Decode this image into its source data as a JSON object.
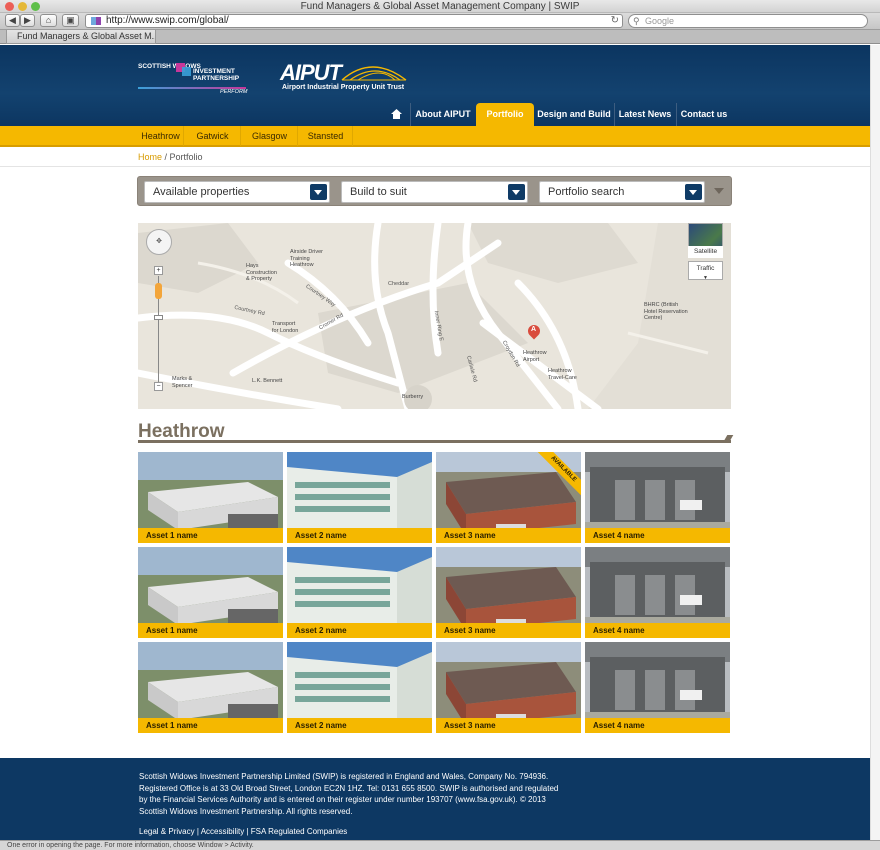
{
  "browser": {
    "window_title": "Fund Managers & Global Asset Management Company | SWIP",
    "url": "http://www.swip.com/global/",
    "search_placeholder": "Google",
    "tab_title": "Fund Managers & Global Asset M...",
    "status_text": "One error in opening the page. For more information, choose Window > Activity.",
    "back_icon": "back-arrow-icon",
    "forward_icon": "forward-arrow-icon"
  },
  "header": {
    "swip_logo_line1": "SCOTTISH WIDOWS",
    "swip_logo_line2": "INVESTMENT PARTNERSHIP",
    "swip_logo_tag": "PERFORM",
    "aiput_logo": "AIPUT",
    "aiput_subtitle": "Airport Industrial Property Unit Trust",
    "accent": "#f5b800",
    "brand_blue": "#0d3863"
  },
  "nav": {
    "home_icon": "home-icon",
    "items": [
      "About AIPUT",
      "Portfolio",
      "Design and Build",
      "Latest News",
      "Contact us"
    ],
    "active": "Portfolio"
  },
  "subnav": {
    "items": [
      "Heathrow",
      "Gatwick",
      "Glasgow",
      "Stansted"
    ]
  },
  "breadcrumb": {
    "home": "Home",
    "separator": " / ",
    "current": "Portfolio"
  },
  "filters": {
    "available": "Available properties",
    "build": "Build to suit",
    "search": "Portfolio search"
  },
  "map": {
    "satellite": "Satellite",
    "traffic": "Traffic",
    "marker": "A",
    "labels": {
      "airside": "Airside Driver\nTraining\nHeathrow",
      "hays": "Hays\nConstruction\n& Property",
      "courtney_rd": "Courtney Rd",
      "courtney_way": "Courtney Way",
      "transport": "Transport\nfor London",
      "cromer_rd": "Cromer Rd",
      "marks": "Marks &\nSpencer",
      "lk_bennett": "L.K. Bennett",
      "burberry": "Burberry",
      "bhrc": "BHRC (British\nHotel Reservation\nCentre)",
      "heathrow_airport": "Heathrow\nAirport",
      "travel_care": "Heathrow\nTravel-Care",
      "cheddar": "Cheddar",
      "inner_ring_e": "Inner Ring E",
      "croydon_rd": "Croydon Rd",
      "carlisle_rd": "Carlisle Rd"
    }
  },
  "section_title": "Heathrow",
  "available_badge": "AVAILABLE",
  "assets": [
    [
      "Asset 1 name",
      "Asset 2 name",
      "Asset 3 name",
      "Asset 4 name"
    ],
    [
      "Asset 1 name",
      "Asset 2 name",
      "Asset 3 name",
      "Asset 4 name"
    ],
    [
      "Asset 1 name",
      "Asset 2 name",
      "Asset 3 name",
      "Asset 4 name"
    ]
  ],
  "footer": {
    "text": "Scottish Widows Investment Partnership Limited (SWIP) is registered in England and Wales, Company No. 794936. Registered Office is at 33 Old Broad Street, London EC2N 1HZ. Tel: 0131 655 8500. SWIP is authorised and regulated by the Financial Services Authority and is entered on their register under number 193707 (www.fsa.gov.uk). © 2013 Scottish Widows Investment Partnership. All rights reserved.",
    "links": [
      "Legal & Privacy",
      "Accessibility",
      "FSA Regulated Companies"
    ],
    "link_separator": " | "
  }
}
